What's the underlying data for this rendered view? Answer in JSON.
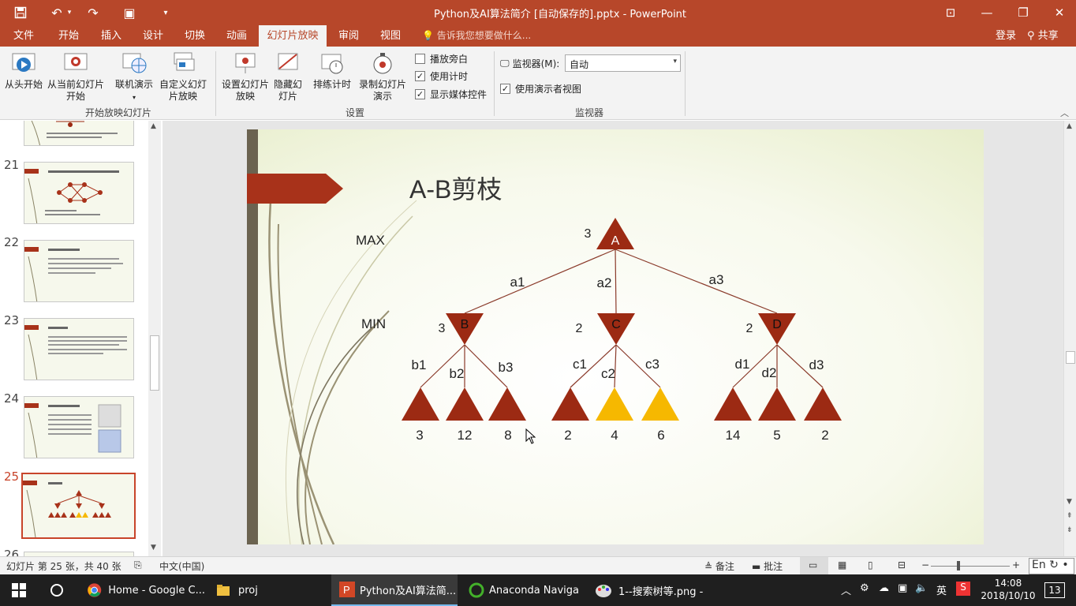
{
  "title_bar": {
    "doc_title": "Python及AI算法简介 [自动保存的].pptx - PowerPoint"
  },
  "tabs": [
    "文件",
    "开始",
    "插入",
    "设计",
    "切换",
    "动画",
    "幻灯片放映",
    "审阅",
    "视图"
  ],
  "tell_me": "告诉我您想要做什么...",
  "account": {
    "login": "登录",
    "share": "共享"
  },
  "ribbon": {
    "buttons": {
      "from_beginning": "从头开始",
      "from_current": "从当前幻灯片开始",
      "online": "联机演示",
      "custom": "自定义幻灯片放映",
      "setup": "设置幻灯片放映",
      "hide": "隐藏幻灯片",
      "rehearse": "排练计时",
      "record": "录制幻灯片演示"
    },
    "checks": {
      "narration": "播放旁白",
      "timings": "使用计时",
      "media_controls": "显示媒体控件",
      "presenter_view": "使用演示者视图"
    },
    "monitor_label": "监视器(M):",
    "monitor_value": "自动",
    "groups": {
      "start": "开始放映幻灯片",
      "setup": "设置",
      "monitors": "监视器"
    }
  },
  "slide_numbers": [
    "21",
    "22",
    "23",
    "24",
    "25",
    "26"
  ],
  "selected_slide": "25",
  "slide": {
    "title": "A-B剪枝",
    "max_label": "MAX",
    "min_label": "MIN",
    "root": {
      "letter": "A",
      "value": "3"
    },
    "min_nodes": [
      {
        "letter": "B",
        "value": "3"
      },
      {
        "letter": "C",
        "value": "2"
      },
      {
        "letter": "D",
        "value": "2"
      }
    ],
    "edges_top": [
      "a1",
      "a2",
      "a3"
    ],
    "edges_bottom": [
      "b1",
      "b2",
      "b3",
      "c1",
      "c2",
      "c3",
      "d1",
      "d2",
      "d3"
    ],
    "leaves": [
      "3",
      "12",
      "8",
      "2",
      "4",
      "6",
      "14",
      "5",
      "2"
    ],
    "colors": {
      "accent": "#9c2a13",
      "pruned": "#f6b800",
      "line": "#8a3a2a"
    }
  },
  "status": {
    "slide_info": "幻灯片 第 25 张，共 40 张",
    "language": "中文(中国)",
    "notes": "备注",
    "comments": "批注"
  },
  "taskbar": {
    "chrome": "Home - Google C...",
    "proj": "proj",
    "powerpoint": "Python及AI算法简...",
    "anaconda": "Anaconda Naviga",
    "paint": "1--搜索树等.png -",
    "ime": "英",
    "lang_badge": "En",
    "time": "14:08",
    "date": "2018/10/10",
    "notif": "13"
  }
}
